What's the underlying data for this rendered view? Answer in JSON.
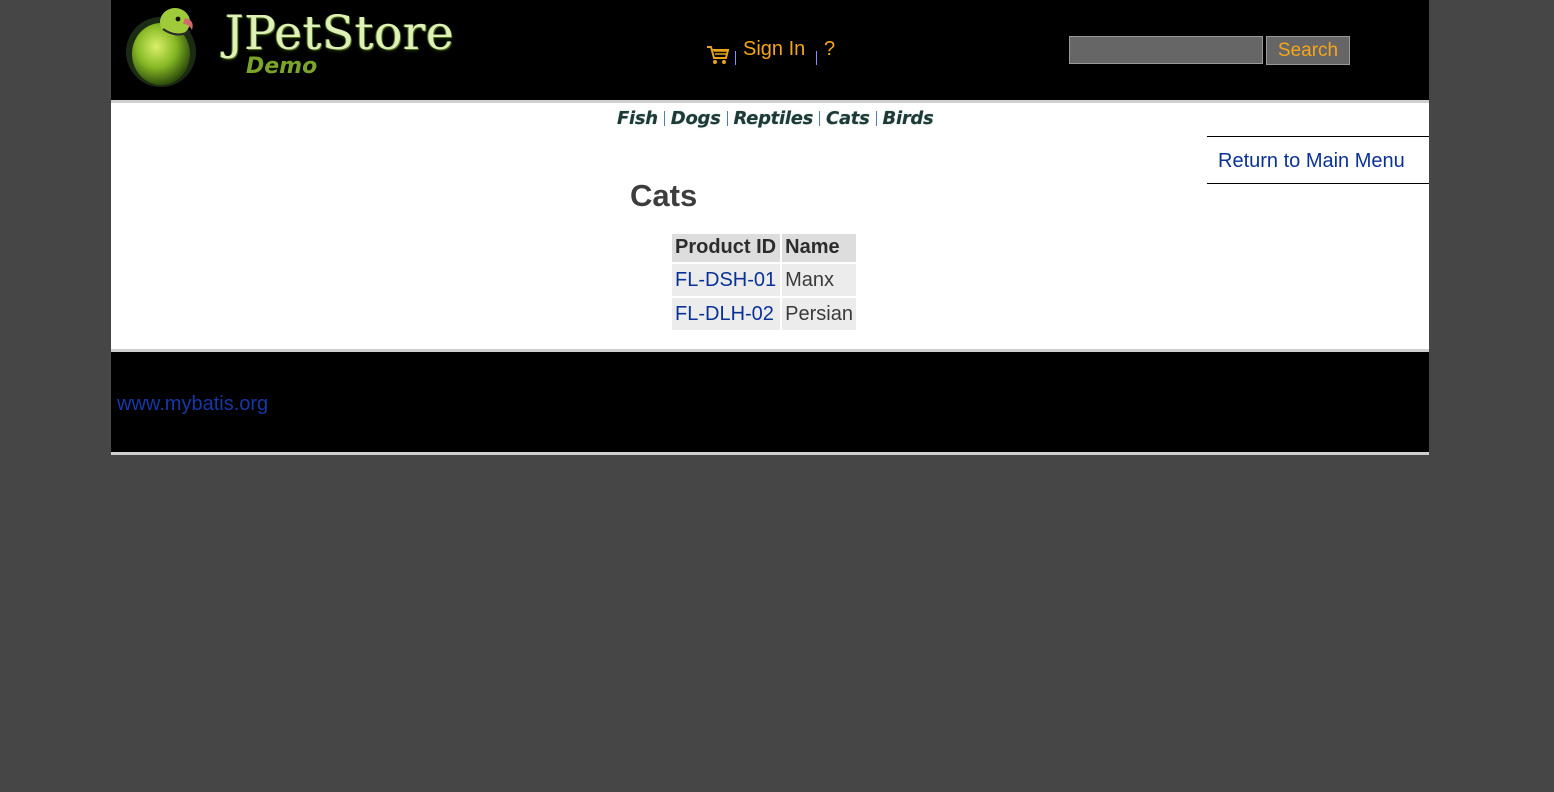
{
  "header": {
    "logo_title": "JPetStore",
    "logo_subtitle": "Demo",
    "sign_in_label": "Sign In",
    "help_label": "?",
    "search": {
      "value": "",
      "button_label": "Search"
    }
  },
  "quicklinks": [
    {
      "label": "Fish"
    },
    {
      "label": "Dogs"
    },
    {
      "label": "Reptiles"
    },
    {
      "label": "Cats"
    },
    {
      "label": "Birds"
    }
  ],
  "sidebar": {
    "return_label": "Return to Main Menu"
  },
  "main": {
    "title": "Cats",
    "table": {
      "headers": [
        "Product ID",
        "Name"
      ],
      "rows": [
        {
          "id": "FL-DSH-01",
          "name": "Manx"
        },
        {
          "id": "FL-DLH-02",
          "name": "Persian"
        }
      ]
    }
  },
  "footer": {
    "link_label": "www.mybatis.org"
  },
  "colors": {
    "background": "#464646",
    "header_bg": "#000000",
    "accent_orange": "#f5a51b",
    "link_blue": "#0a3296",
    "title_text": "#3d3d3d"
  },
  "icons": {
    "cart": "cart-icon",
    "logo": "parrot-logo-icon"
  }
}
